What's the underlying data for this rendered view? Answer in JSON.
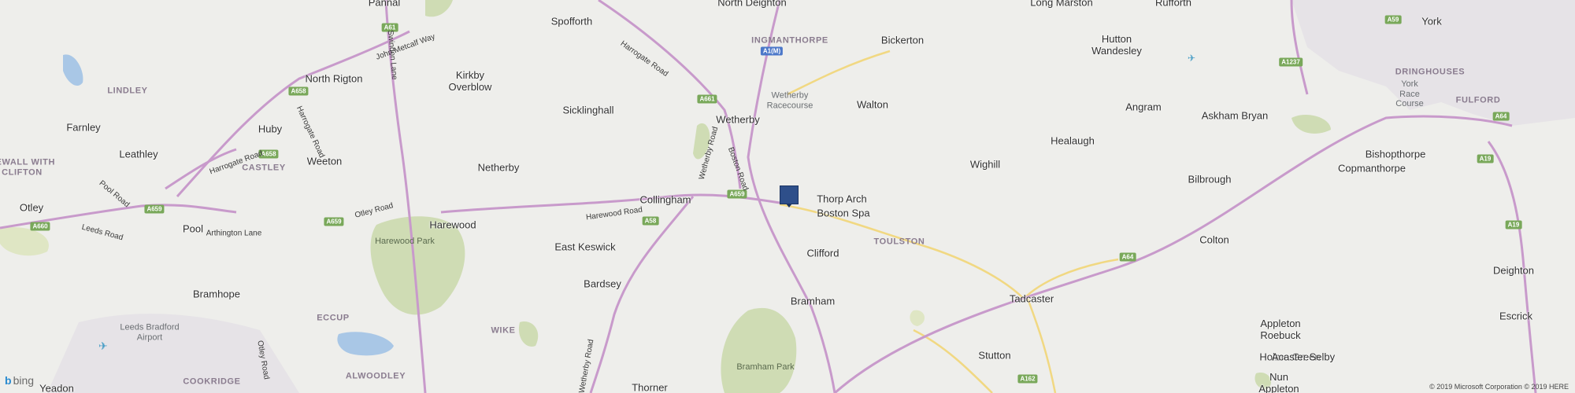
{
  "map": {
    "places": [
      {
        "name": "Pannal",
        "cls": "lbl"
      },
      {
        "name": "North Deighton",
        "cls": "lbl"
      },
      {
        "name": "Spofforth",
        "cls": "lbl"
      },
      {
        "name": "Bickerton",
        "cls": "lbl"
      },
      {
        "name": "Long Marston",
        "cls": "lbl"
      },
      {
        "name": "Rufforth",
        "cls": "lbl"
      },
      {
        "name": "Hutton\nWandesley",
        "cls": "lbl"
      },
      {
        "name": "York",
        "cls": "lbl"
      },
      {
        "name": "North Rigton",
        "cls": "lbl"
      },
      {
        "name": "Kirkby\nOverblow",
        "cls": "lbl"
      },
      {
        "name": "Sicklinghall",
        "cls": "lbl"
      },
      {
        "name": "Wetherby",
        "cls": "lbl"
      },
      {
        "name": "Walton",
        "cls": "lbl"
      },
      {
        "name": "Angram",
        "cls": "lbl"
      },
      {
        "name": "Askham Bryan",
        "cls": "lbl"
      },
      {
        "name": "Farnley",
        "cls": "lbl"
      },
      {
        "name": "Huby",
        "cls": "lbl"
      },
      {
        "name": "Leathley",
        "cls": "lbl"
      },
      {
        "name": "Weeton",
        "cls": "lbl"
      },
      {
        "name": "Netherby",
        "cls": "lbl"
      },
      {
        "name": "Wighill",
        "cls": "lbl"
      },
      {
        "name": "Healaugh",
        "cls": "lbl"
      },
      {
        "name": "Bishopthorpe",
        "cls": "lbl"
      },
      {
        "name": "Bilbrough",
        "cls": "lbl"
      },
      {
        "name": "Copmanthorpe",
        "cls": "lbl"
      },
      {
        "name": "Collingham",
        "cls": "lbl"
      },
      {
        "name": "Thorp Arch",
        "cls": "lbl"
      },
      {
        "name": "Boston Spa",
        "cls": "lbl"
      },
      {
        "name": "Otley",
        "cls": "lbl"
      },
      {
        "name": "Pool",
        "cls": "lbl"
      },
      {
        "name": "Harewood",
        "cls": "lbl"
      },
      {
        "name": "East Keswick",
        "cls": "lbl"
      },
      {
        "name": "Clifford",
        "cls": "lbl"
      },
      {
        "name": "Colton",
        "cls": "lbl"
      },
      {
        "name": "Deighton",
        "cls": "lbl"
      },
      {
        "name": "Bardsey",
        "cls": "lbl"
      },
      {
        "name": "Bramhope",
        "cls": "lbl"
      },
      {
        "name": "Bramham",
        "cls": "lbl"
      },
      {
        "name": "Tadcaster",
        "cls": "lbl"
      },
      {
        "name": "Escrick",
        "cls": "lbl"
      },
      {
        "name": "Appleton\nRoebuck",
        "cls": "lbl"
      },
      {
        "name": "Holme Green",
        "cls": "lbl"
      },
      {
        "name": "Acaster Selby",
        "cls": "lbl"
      },
      {
        "name": "Stutton",
        "cls": "lbl"
      },
      {
        "name": "Yeadon",
        "cls": "lbl"
      },
      {
        "name": "Thorner",
        "cls": "lbl"
      },
      {
        "name": "Nun\nAppleton",
        "cls": "lbl"
      },
      {
        "name": "Leeds Bradford\nAirport",
        "cls": "poi"
      },
      {
        "name": "Wetherby\nRacecourse",
        "cls": "poi"
      },
      {
        "name": "York\nRace\nCourse",
        "cls": "poi"
      },
      {
        "name": "INGMANTHORPE",
        "cls": "dist"
      },
      {
        "name": "DRINGHOUSES",
        "cls": "dist"
      },
      {
        "name": "FULFORD",
        "cls": "dist"
      },
      {
        "name": "LINDLEY",
        "cls": "dist"
      },
      {
        "name": "NEWALL WITH\nCLIFTON",
        "cls": "dist"
      },
      {
        "name": "CASTLEY",
        "cls": "dist"
      },
      {
        "name": "TOULSTON",
        "cls": "dist"
      },
      {
        "name": "ECCUP",
        "cls": "dist"
      },
      {
        "name": "WIKE",
        "cls": "dist"
      },
      {
        "name": "COOKRIDGE",
        "cls": "dist"
      },
      {
        "name": "ALWOODLEY",
        "cls": "dist"
      },
      {
        "name": "Harewood Park",
        "cls": "park"
      },
      {
        "name": "Bramham Park",
        "cls": "park"
      }
    ],
    "road_shields": [
      {
        "text": "A61",
        "type": "a"
      },
      {
        "text": "A1(M)",
        "type": "mw"
      },
      {
        "text": "A59",
        "type": "a"
      },
      {
        "text": "A1237",
        "type": "a"
      },
      {
        "text": "A658",
        "type": "a"
      },
      {
        "text": "A661",
        "type": "a"
      },
      {
        "text": "A64",
        "type": "a"
      },
      {
        "text": "A658",
        "type": "a"
      },
      {
        "text": "A19",
        "type": "a"
      },
      {
        "text": "A659",
        "type": "a"
      },
      {
        "text": "A659",
        "type": "a"
      },
      {
        "text": "A659",
        "type": "a"
      },
      {
        "text": "A660",
        "type": "a"
      },
      {
        "text": "A58",
        "type": "a"
      },
      {
        "text": "A19",
        "type": "a"
      },
      {
        "text": "A64",
        "type": "a"
      },
      {
        "text": "A162",
        "type": "a"
      }
    ],
    "road_names": [
      "John Metcalf Way",
      "Harrogate Road",
      "Swindon Lane",
      "Harrogate Road",
      "Harrogate Road",
      "Wetherby Road",
      "Boston Road",
      "Pool Road",
      "Otley Road",
      "Arthington Lane",
      "Harewood Road",
      "Leeds Road",
      "Otley Road",
      "Wetherby Road"
    ],
    "pin": {
      "label": "location-pin"
    },
    "brand": {
      "logo": "b",
      "name": "bing"
    },
    "copyright": "© 2019 Microsoft Corporation © 2019 HERE"
  }
}
